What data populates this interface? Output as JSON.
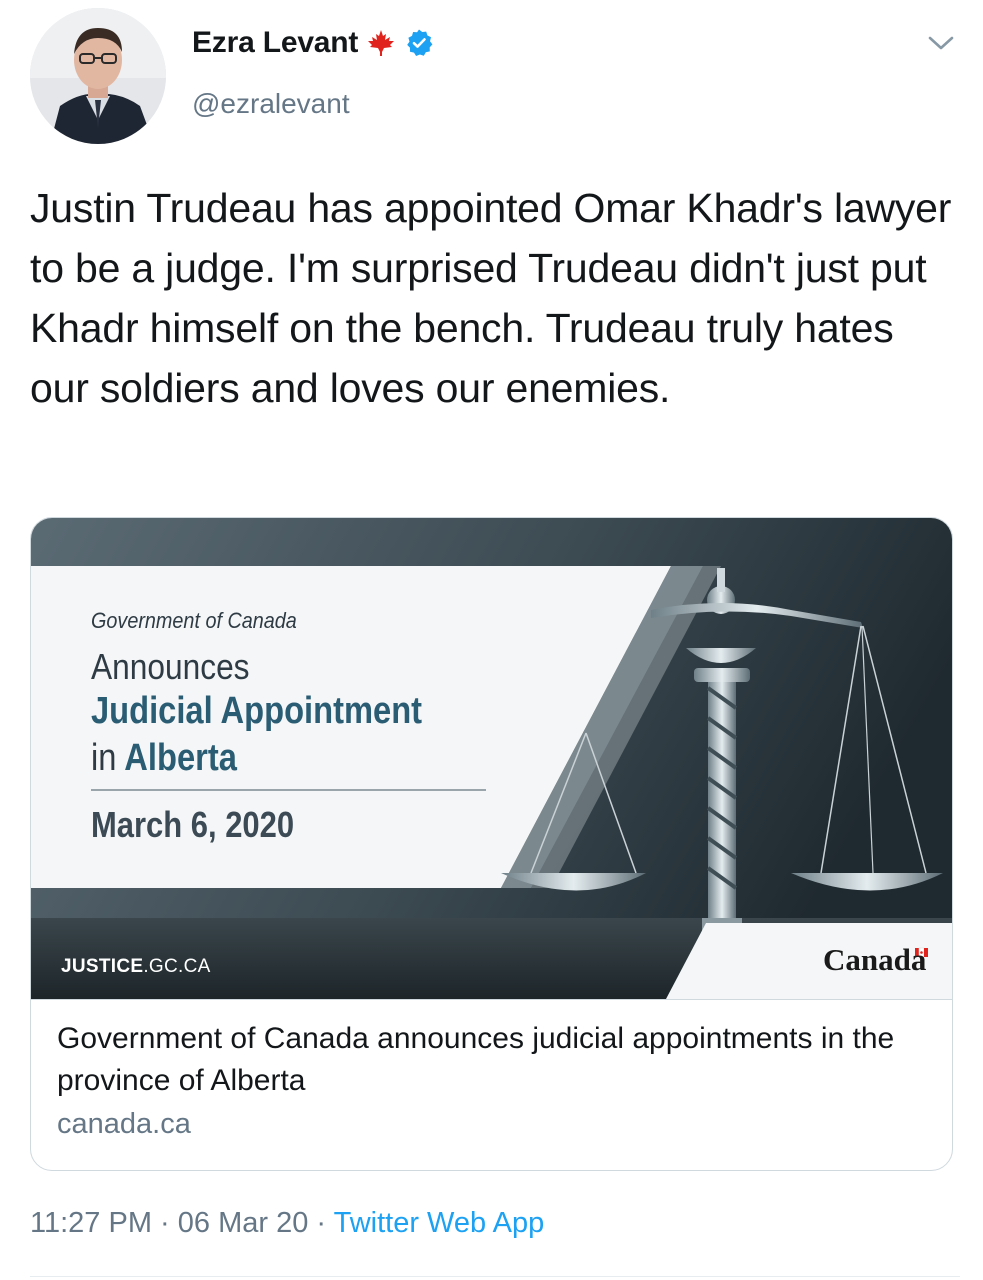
{
  "author": {
    "display_name": "Ezra Levant",
    "handle": "@ezralevant",
    "flag_icon": "maple-leaf-icon",
    "verified_icon": "verified-badge-icon",
    "verified_color": "#1da1f2",
    "flag_color": "#e0241d"
  },
  "menu": {
    "icon": "chevron-down-icon"
  },
  "tweet": {
    "text": "Justin Trudeau has appointed Omar Khadr's lawyer to be a judge. I'm surprised Trudeau didn't just put Khadr himself on the bench. Trudeau truly hates our soldiers and loves our enemies."
  },
  "card": {
    "image": {
      "gov_label": "Government of Canada",
      "announces": "Announces",
      "headline_line1": "Judicial Appointment",
      "headline_in": "in",
      "headline_place": "Alberta",
      "date": "March 6, 2020",
      "site_bold": "JUSTICE",
      "site_rest": ".GC.CA",
      "wordmark": "Canada",
      "headline_color": "#2a5d73"
    },
    "title": "Government of Canada announces judicial appointments in the province of Alberta",
    "domain": "canada.ca"
  },
  "footer": {
    "time": "11:27 PM",
    "separator1": " · ",
    "date": "06 Mar 20",
    "separator2": " · ",
    "source": "Twitter Web App",
    "source_color": "#1da1f2"
  }
}
